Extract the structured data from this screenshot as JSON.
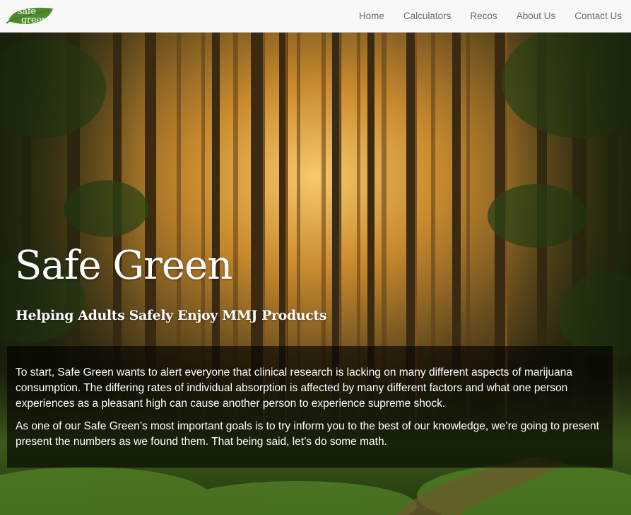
{
  "brand": {
    "logo_line1": "safe",
    "logo_line2": "green",
    "leaf_color": "#4e8a2e"
  },
  "nav": {
    "items": [
      {
        "label": "Home"
      },
      {
        "label": "Calculators"
      },
      {
        "label": "Recos"
      },
      {
        "label": "About Us"
      },
      {
        "label": "Contact Us"
      }
    ]
  },
  "hero": {
    "title": "Safe Green",
    "subtitle": "Helping Adults Safely Enjoy MMJ Products",
    "paragraphs": [
      "To start, Safe Green wants to alert everyone that clinical research is lacking on many different aspects of marijuana consumption. The differing rates of individual absorption is affected by many different factors and what one person experiences as a pleasant high can cause another person to experience supreme shock.",
      "As one of our Safe Green’s most important goals is to try inform you to the best of our knowledge, we’re going to present present the numbers as we found them. That being said, let’s do some math."
    ]
  },
  "colors": {
    "header_bg": "#f8f8f8",
    "nav_text": "#6b6b6b",
    "panel_bg": "rgba(0,0,0,0.62)"
  }
}
